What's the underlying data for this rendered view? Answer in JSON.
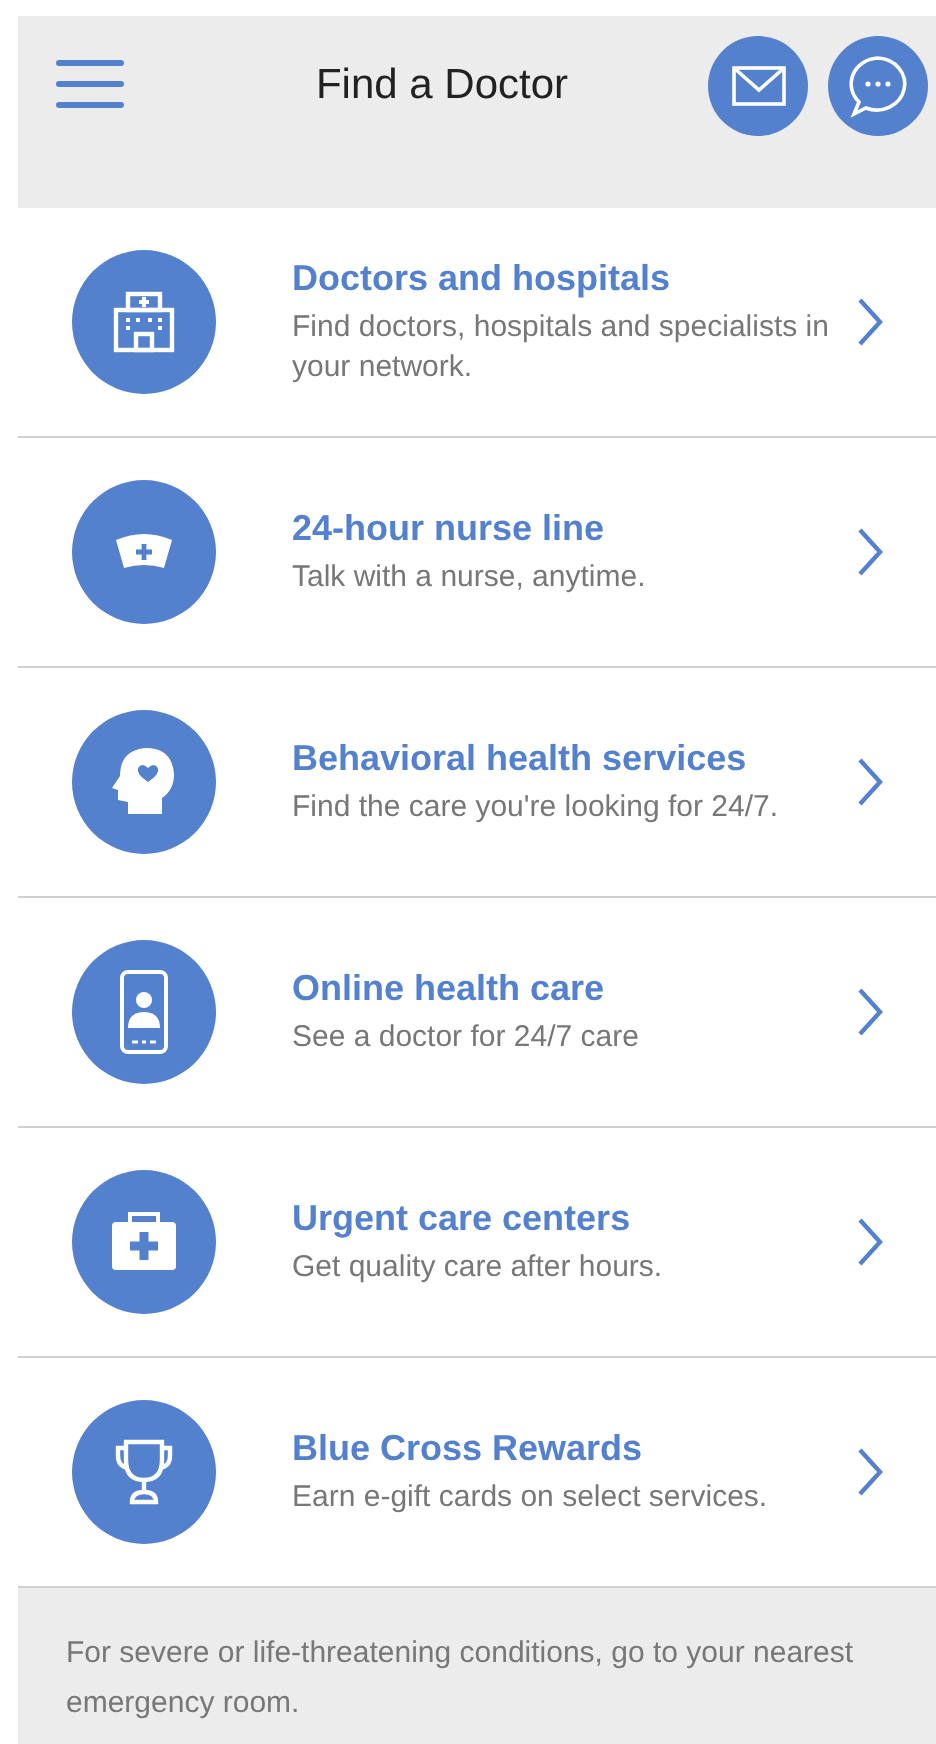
{
  "header": {
    "title": "Find a Doctor"
  },
  "items": [
    {
      "kind": "hospital",
      "title": "Doctors and hospitals",
      "subtitle": "Find doctors, hospitals and specialists in your network."
    },
    {
      "kind": "nurse",
      "title": "24-hour nurse line",
      "subtitle": "Talk with a nurse, anytime."
    },
    {
      "kind": "behavioral",
      "title": "Behavioral health services",
      "subtitle": "Find the care you're looking for 24/7."
    },
    {
      "kind": "online",
      "title": "Online health care",
      "subtitle": "See a doctor for 24/7 care"
    },
    {
      "kind": "urgent",
      "title": "Urgent care centers",
      "subtitle": "Get quality care after hours."
    },
    {
      "kind": "rewards",
      "title": "Blue Cross Rewards",
      "subtitle": "Earn e-gift cards on select services."
    }
  ],
  "footer": {
    "text": "For severe or life-threatening conditions, go to your nearest emergency room."
  }
}
